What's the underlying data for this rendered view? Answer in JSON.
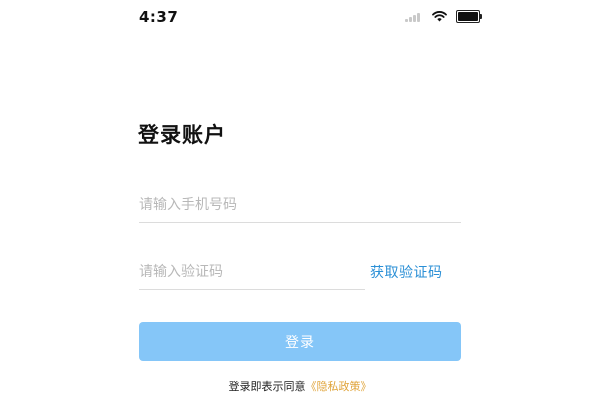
{
  "status_bar": {
    "time": "4:37"
  },
  "icons": {
    "signal": "signal-icon",
    "wifi": "wifi-icon",
    "battery": "battery-icon"
  },
  "login": {
    "title": "登录账户",
    "phone_placeholder": "请输入手机号码",
    "phone_value": "",
    "code_placeholder": "请输入验证码",
    "code_value": "",
    "get_code_label": "获取验证码",
    "submit_label": "登录",
    "agreement_prefix": "登录即表示同意",
    "privacy_link": "《隐私政策》"
  },
  "colors": {
    "accent": "#2a8fd6",
    "button_disabled": "#85c6f8",
    "link": "#e0a43a"
  }
}
